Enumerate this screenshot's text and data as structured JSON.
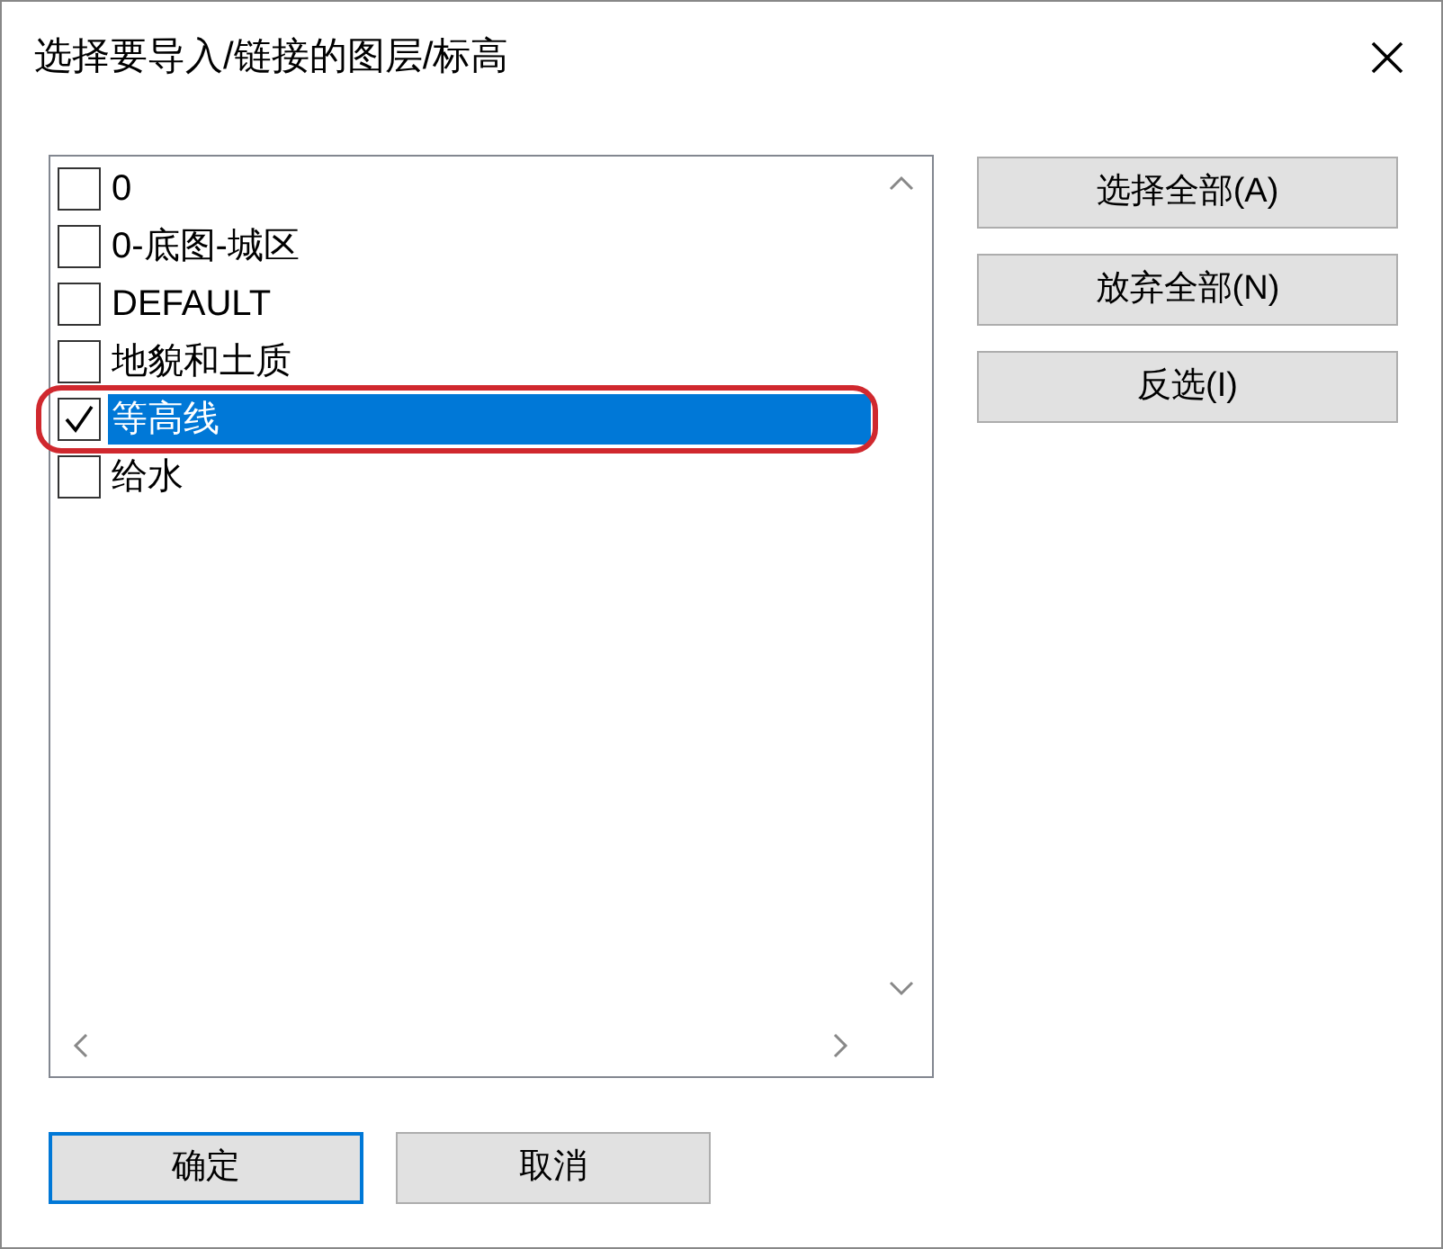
{
  "window": {
    "title": "选择要导入/链接的图层/标高"
  },
  "layers": [
    {
      "label": "0",
      "checked": false,
      "selected": false
    },
    {
      "label": "0-底图-城区",
      "checked": false,
      "selected": false
    },
    {
      "label": "DEFAULT",
      "checked": false,
      "selected": false
    },
    {
      "label": "地貌和土质",
      "checked": false,
      "selected": false
    },
    {
      "label": "等高线",
      "checked": true,
      "selected": true
    },
    {
      "label": "给水",
      "checked": false,
      "selected": false
    }
  ],
  "side_buttons": [
    "选择全部(A)",
    "放弃全部(N)",
    "反选(I)"
  ],
  "footer_buttons": [
    {
      "label": "确定",
      "kind": "default"
    },
    {
      "label": "取消",
      "kind": "normal"
    }
  ]
}
